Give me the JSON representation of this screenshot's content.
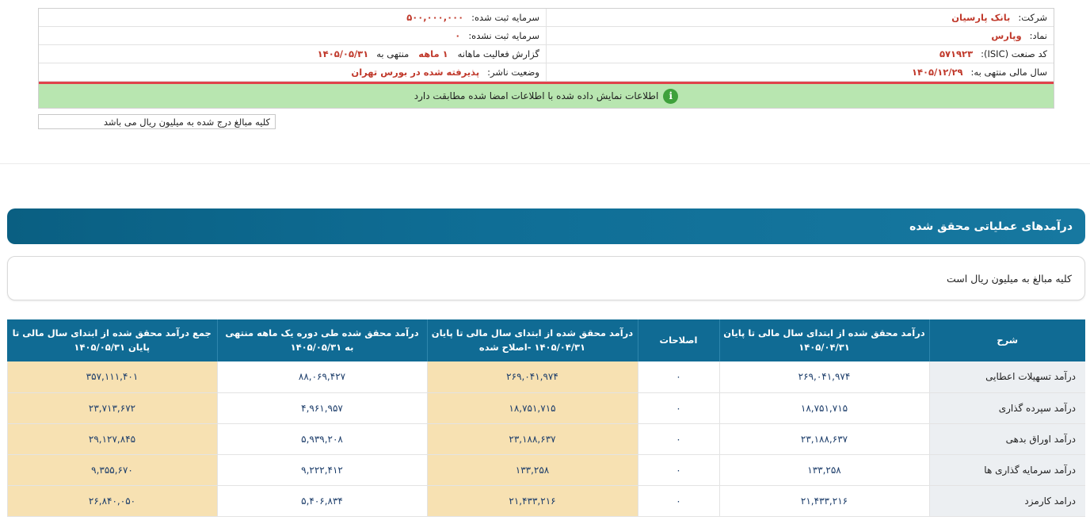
{
  "company_info": {
    "company_label": "شرکت:",
    "company_value": "بانک پارسیان",
    "registered_capital_label": "سرمایه ثبت شده:",
    "registered_capital_value": "۵۰۰,۰۰۰,۰۰۰",
    "symbol_label": "نماد:",
    "symbol_value": "وپارس",
    "unregistered_capital_label": "سرمایه ثبت نشده:",
    "unregistered_capital_value": "۰",
    "isic_label": "کد صنعت (ISIC):",
    "isic_value": "۵۷۱۹۲۳",
    "report_label": "گزارش فعالیت ماهانه",
    "report_period_value": "۱ ماهه",
    "report_end_label": "منتهی به",
    "report_end_value": "۱۴۰۵/۰۵/۳۱",
    "fiscal_year_label": "سال مالی منتهی به:",
    "fiscal_year_value": "۱۴۰۵/۱۲/۲۹",
    "publisher_status_label": "وضعیت ناشر:",
    "publisher_status_value": "پذیرفته شده در بورس تهران"
  },
  "notice": {
    "text": "اطلاعات نمایش داده شده با اطلاعات امضا شده مطابقت دارد",
    "icon": "info-icon",
    "icon_glyph": "i"
  },
  "unit_note": "کلیه مبالغ درج شده به میلیون ریال می باشد",
  "section": {
    "title": "درآمدهای عملیاتی محقق شده",
    "unit_text": "کلیه مبالغ به میلیون ریال است"
  },
  "table": {
    "headers": [
      "شرح",
      "درآمد محقق شده از ابتدای سال مالی تا پایان ۱۴۰۵/۰۴/۳۱",
      "اصلاحات",
      "درآمد محقق شده از ابتدای سال مالی تا پایان ۱۴۰۵/۰۴/۳۱ -اصلاح شده",
      "درآمد محقق شده طی دوره یک ماهه منتهی به ۱۴۰۵/۰۵/۳۱",
      "جمع درآمد محقق شده از ابتدای سال مالی تا پایان ۱۴۰۵/۰۵/۳۱"
    ],
    "rows": [
      [
        "درآمد تسهیلات اعطایی",
        "۲۶۹,۰۴۱,۹۷۴",
        "۰",
        "۲۶۹,۰۴۱,۹۷۴",
        "۸۸,۰۶۹,۴۲۷",
        "۳۵۷,۱۱۱,۴۰۱"
      ],
      [
        "درآمد سپرده گذاری",
        "۱۸,۷۵۱,۷۱۵",
        "۰",
        "۱۸,۷۵۱,۷۱۵",
        "۴,۹۶۱,۹۵۷",
        "۲۳,۷۱۳,۶۷۲"
      ],
      [
        "درآمد اوراق بدهی",
        "۲۳,۱۸۸,۶۳۷",
        "۰",
        "۲۳,۱۸۸,۶۳۷",
        "۵,۹۳۹,۲۰۸",
        "۲۹,۱۲۷,۸۴۵"
      ],
      [
        "درآمد سرمایه گذاری ها",
        "۱۳۳,۲۵۸",
        "۰",
        "۱۳۳,۲۵۸",
        "۹,۲۲۲,۴۱۲",
        "۹,۳۵۵,۶۷۰"
      ],
      [
        "درامد کارمزد",
        "۲۱,۴۳۳,۲۱۶",
        "۰",
        "۲۱,۴۳۳,۲۱۶",
        "۵,۴۰۶,۸۳۴",
        "۲۶,۸۴۰,۰۵۰"
      ]
    ]
  }
}
